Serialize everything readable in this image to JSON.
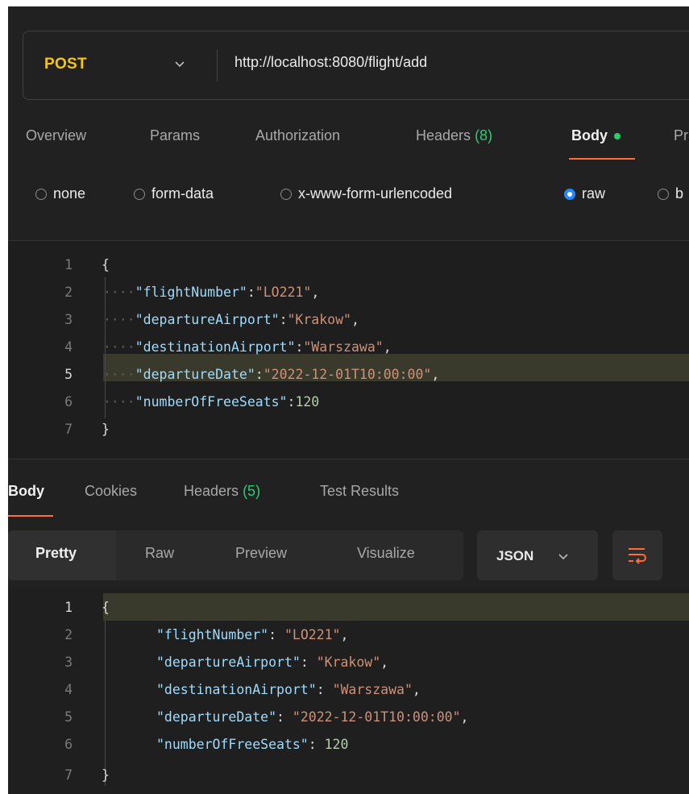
{
  "request": {
    "method": "POST",
    "url": "http://localhost:8080/flight/add"
  },
  "request_tabs": [
    {
      "label": "Overview"
    },
    {
      "label": "Params"
    },
    {
      "label": "Authorization"
    },
    {
      "label": "Headers",
      "count": "(8)"
    },
    {
      "label": "Body",
      "active": true
    },
    {
      "label": "Pr"
    }
  ],
  "body_types": [
    {
      "label": "none"
    },
    {
      "label": "form-data"
    },
    {
      "label": "x-www-form-urlencoded"
    },
    {
      "label": "raw",
      "selected": true
    },
    {
      "label": "b"
    }
  ],
  "request_body": {
    "line_numbers": [
      "1",
      "2",
      "3",
      "4",
      "5",
      "6",
      "7"
    ],
    "open_brace": "{",
    "close_brace": "}",
    "fields": [
      {
        "key": "\"flightNumber\"",
        "value": "\"LO221\""
      },
      {
        "key": "\"departureAirport\"",
        "value": "\"Krakow\""
      },
      {
        "key": "\"destinationAirport\"",
        "value": "\"Warszawa\""
      },
      {
        "key": "\"departureDate\"",
        "value": "\"2022-12-01T10:00:00\""
      },
      {
        "key": "\"numberOfFreeSeats\"",
        "value": "120"
      }
    ]
  },
  "response_tabs": [
    {
      "label": "Body",
      "active": true
    },
    {
      "label": "Cookies"
    },
    {
      "label": "Headers",
      "count": "(5)"
    },
    {
      "label": "Test Results"
    }
  ],
  "response_view": {
    "modes": [
      "Pretty",
      "Raw",
      "Preview",
      "Visualize"
    ],
    "format": "JSON",
    "wrap_icon": "wrap-lines-icon"
  },
  "response_body": {
    "line_numbers": [
      "1",
      "2",
      "3",
      "4",
      "5",
      "6",
      "7"
    ],
    "open_brace": "{",
    "close_brace": "}",
    "fields": [
      {
        "key": "\"flightNumber\"",
        "value": "\"LO221\""
      },
      {
        "key": "\"departureAirport\"",
        "value": "\"Krakow\""
      },
      {
        "key": "\"destinationAirport\"",
        "value": "\"Warszawa\""
      },
      {
        "key": "\"departureDate\"",
        "value": "\"2022-12-01T10:00:00\""
      },
      {
        "key": "\"numberOfFreeSeats\"",
        "value": "120"
      }
    ]
  },
  "colors": {
    "method": "#f5c518",
    "accent": "#ff6c37",
    "count": "#2ecc71",
    "radio_selected": "#1f8bff"
  }
}
